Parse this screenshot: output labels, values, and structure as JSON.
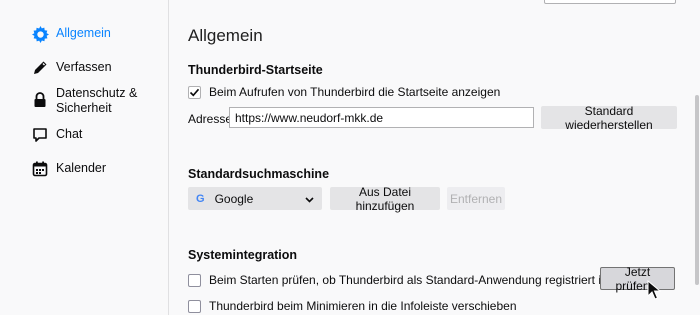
{
  "sidebar": {
    "items": [
      {
        "label": "Allgemein",
        "icon": "gear-icon",
        "active": true
      },
      {
        "label": "Verfassen",
        "icon": "pencil-icon"
      },
      {
        "label": "Datenschutz &\nSicherheit",
        "icon": "lock-icon"
      },
      {
        "label": "Chat",
        "icon": "chat-bubble-icon"
      },
      {
        "label": "Kalender",
        "icon": "calendar-icon"
      }
    ]
  },
  "main": {
    "title": "Allgemein",
    "startpage": {
      "section_title": "Thunderbird-Startseite",
      "show_checkbox_label": "Beim Aufrufen von Thunderbird die Startseite anzeigen",
      "show_checked": true,
      "address_label": "Adresse:",
      "address_value": "https://www.neudorf-mkk.de",
      "restore_button": "Standard wiederherstellen"
    },
    "search": {
      "section_title": "Standardsuchmaschine",
      "engine_selected": "Google",
      "add_file_button": "Aus Datei hinzufügen",
      "remove_button": "Entfernen"
    },
    "system": {
      "section_title": "Systemintegration",
      "check_default_label": "Beim Starten prüfen, ob Thunderbird als Standard-Anwendung registriert ist",
      "check_now_button": "Jetzt prüfen...",
      "minimize_tray_label": "Thunderbird beim Minimieren in die Infoleiste verschieben"
    }
  },
  "colors": {
    "accent": "#0a84ff",
    "background": "#f9f9fa"
  }
}
